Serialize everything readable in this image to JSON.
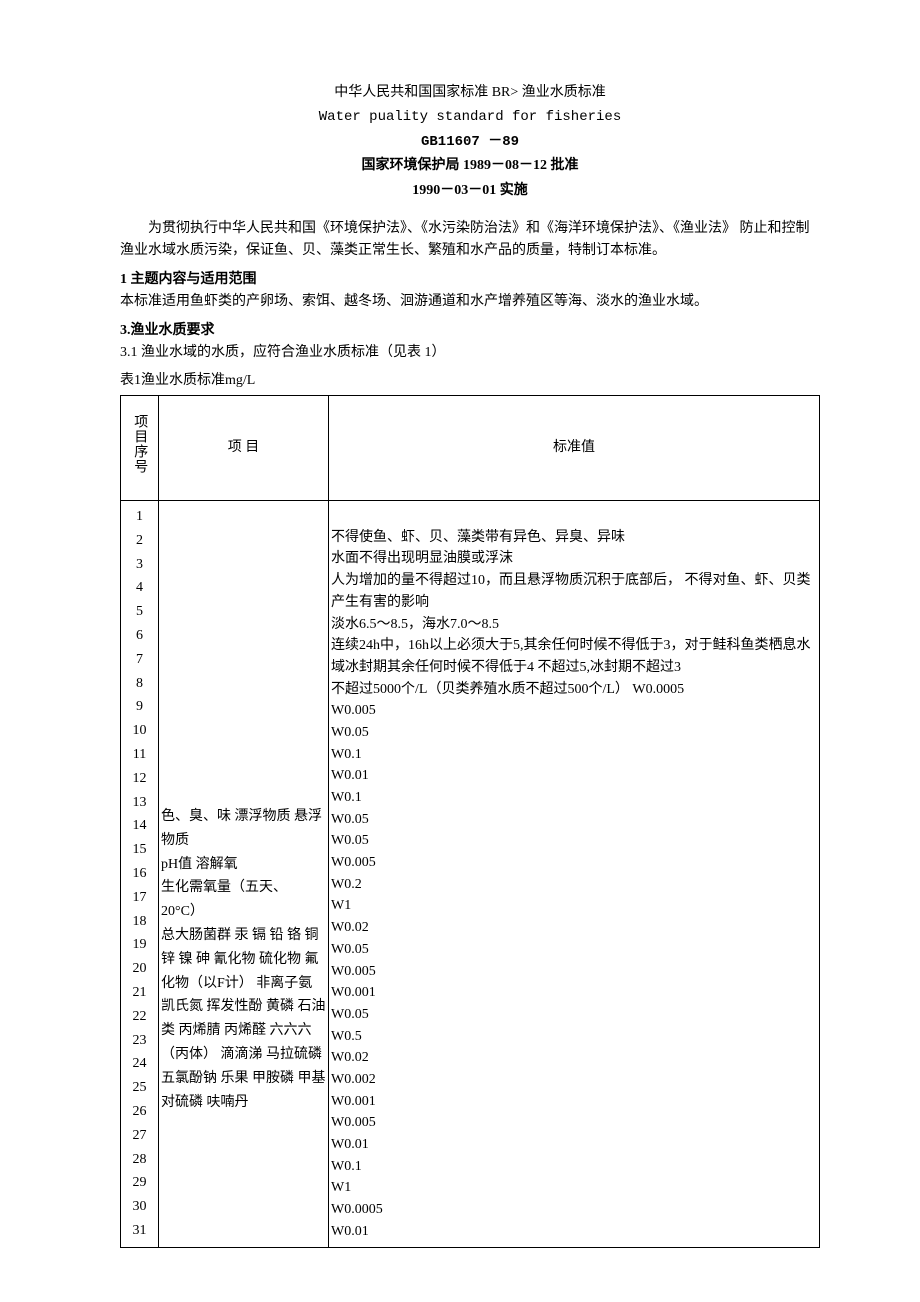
{
  "header": {
    "title_cn": "中华人民共和国国家标准 BR> 渔业水质标准",
    "title_en": "Water puality standard for fisheries",
    "code": "GB11607 －89",
    "approve": "国家环境保护局 1989－08－12 批准",
    "effective": "1990－03－01 实施"
  },
  "intro": "为贯彻执行中华人民共和国《环境保护法》、《水污染防治法》和《海洋环境保护法》、《渔业法》 防止和控制渔业水域水质污染，保证鱼、贝、藻类正常生长、繁殖和水产品的质量，特制订本标准。",
  "sec1_title": "1 主题内容与适用范围",
  "sec1_body": "本标准适用鱼虾类的产卵场、索饵、越冬场、洄游通道和水产增养殖区等海、淡水的渔业水域。",
  "sec3_title": "3.渔业水质要求",
  "sec3_body": "3.1  渔业水域的水质，应符合渔业水质标准（见表 1）",
  "table_caption": "表1渔业水质标准mg/L",
  "table": {
    "col_seq": "项目序号",
    "col_item": "项      目",
    "col_val": "标准值",
    "seq": [
      "1",
      "2",
      "3",
      "4",
      "5",
      "6",
      "7",
      "8",
      "9",
      "10",
      "11",
      "12",
      "13",
      "14",
      "15",
      "16",
      "17",
      "18",
      "19",
      "20",
      "21",
      "22",
      "23",
      "24",
      "25",
      "26",
      "27",
      "28",
      "29",
      "30",
      "31"
    ],
    "items": "色、臭、味 漂浮物质 悬浮物质\npH值 溶解氧\n生化需氧量（五天、20°C）\n总大肠菌群 汞 镉 铅 铬 铜 锌 镍 砷 氰化物 硫化物 氟化物（以F计） 非离子氨 凯氏氮 挥发性酚 黄磷 石油类 丙烯腈 丙烯醛 六六六（丙体） 滴滴涕 马拉硫磷 五氯酚钠 乐果 甲胺磷 甲基对硫磷 呋喃丹",
    "values": [
      "",
      "不得使鱼、虾、贝、藻类带有异色、异臭、异味",
      "水面不得出现明显油膜或浮沫",
      "人为增加的量不得超过10，而且悬浮物质沉积于底部后， 不得对鱼、虾、贝类产生有害的影响",
      "淡水6.5～8.5，海水7.0～8.5",
      "连续24h中，16h以上必须大于5,其余任何时候不得低于3，对于鲑科鱼类栖息水域冰封期其余任何时候不得低于4 不超过5,冰封期不超过3",
      "不超过5000个/L（贝类养殖水质不超过500个/L） W0.0005",
      "W0.005",
      "W0.05",
      "W0.1",
      "W0.01",
      "W0.1",
      "W0.05",
      "W0.05",
      "W0.005",
      "W0.2",
      "W1",
      "W0.02",
      "W0.05",
      "W0.005",
      "W0.001",
      "W0.05",
      "W0.5",
      "W0.02",
      "W0.002",
      "W0.001",
      "W0.005",
      "W0.01",
      "W0.1",
      "W1",
      "W0.0005",
      "W0.01"
    ]
  }
}
